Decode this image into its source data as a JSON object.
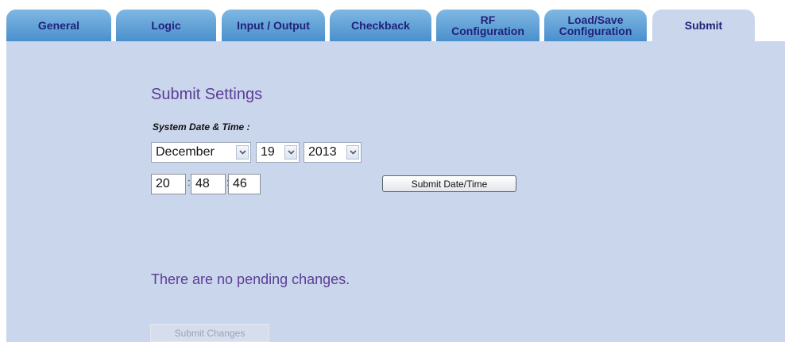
{
  "tabs": [
    {
      "label": "General"
    },
    {
      "label": "Logic"
    },
    {
      "label": "Input / Output"
    },
    {
      "label": "Checkback"
    },
    {
      "label_line1": "RF",
      "label_line2": "Configuration"
    },
    {
      "label_line1": "Load/Save",
      "label_line2": "Configuration"
    },
    {
      "label": "Submit",
      "active": true
    }
  ],
  "colors": {
    "tab_gradient_top": "#7fb8e3",
    "tab_gradient_bottom": "#4a90cc",
    "panel_bg": "#cad6ec",
    "heading_text": "#5a3d96",
    "tab_text": "#22207a"
  },
  "main": {
    "title": "Submit Settings",
    "datetime_label": "System Date & Time :",
    "month": "December",
    "day": "19",
    "year": "2013",
    "hour": "20",
    "minute": "48",
    "second": "46",
    "time_separator": ":",
    "submit_datetime_label": "Submit Date/Time",
    "pending_message": "There are no pending changes.",
    "submit_changes_label": "Submit Changes"
  }
}
